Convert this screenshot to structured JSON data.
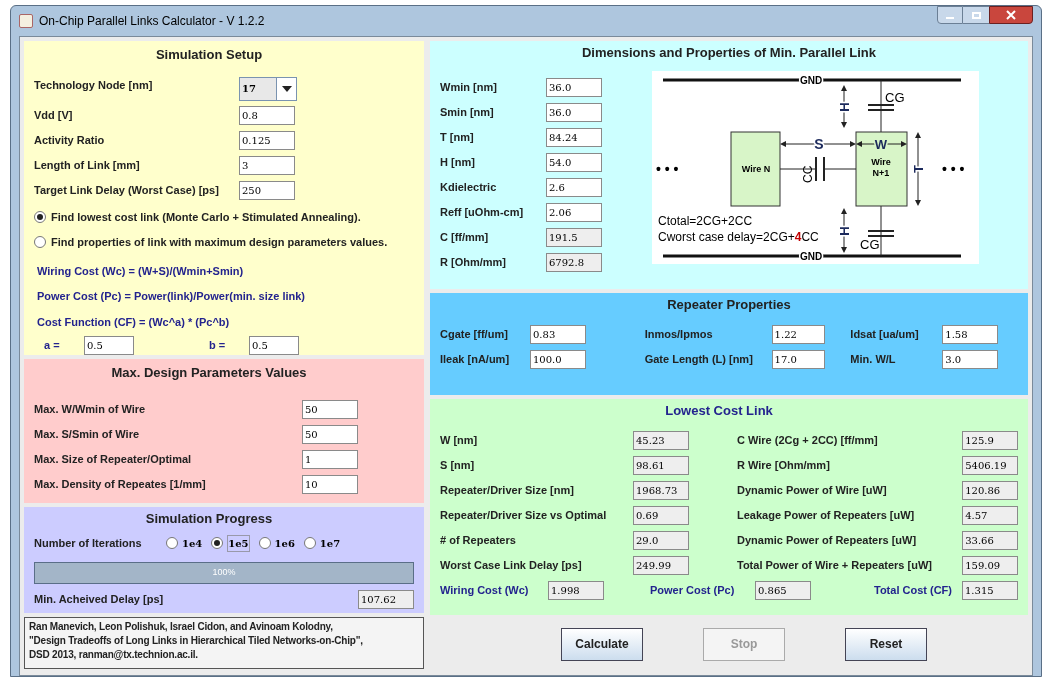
{
  "window": {
    "title": "On-Chip Parallel Links Calculator -  V 1.2.2"
  },
  "simulation_setup": {
    "title": "Simulation Setup",
    "node": {
      "label": "Technology Node [nm]",
      "value": "17"
    },
    "fields": [
      {
        "label": "Vdd [V]",
        "value": "0.8"
      },
      {
        "label": "Activity Ratio",
        "value": "0.125"
      },
      {
        "label": "Length of Link [mm]",
        "value": "3"
      },
      {
        "label": "Target Link Delay (Worst Case) [ps]",
        "value": "250"
      }
    ],
    "modes": [
      {
        "label": "Find lowest cost link (Monte Carlo + Stimulated Annealing).",
        "selected": true
      },
      {
        "label": "Find properties of link with maximum design parameters values.",
        "selected": false
      }
    ],
    "formulas": [
      "Wiring Cost (Wc) = (W+S)/(Wmin+Smin)",
      "Power Cost (Pc) = Power(link)/Power(min. size link)",
      "Cost Function (CF) = (Wc^a) * (Pc^b)"
    ],
    "exponents": [
      {
        "label": "a =",
        "value": "0.5"
      },
      {
        "label": "b =",
        "value": "0.5"
      }
    ]
  },
  "max_design": {
    "title": "Max. Design Parameters Values",
    "fields": [
      {
        "label": "Max. W/Wmin of Wire",
        "value": "50"
      },
      {
        "label": "Max. S/Smin of Wire",
        "value": "50"
      },
      {
        "label": "Max. Size of Repeater/Optimal",
        "value": "1"
      },
      {
        "label": "Max. Density of Repeates [1/mm]",
        "value": "10"
      }
    ]
  },
  "progress": {
    "title": "Simulation Progress",
    "iterations_label": "Number of Iterations",
    "iterations": [
      {
        "label": "1e4",
        "selected": false
      },
      {
        "label": "1e5",
        "selected": true
      },
      {
        "label": "1e6",
        "selected": false
      },
      {
        "label": "1e7",
        "selected": false
      }
    ],
    "bar": {
      "level": 1,
      "text": "100%"
    },
    "delay": {
      "label": "Min. Acheived Delay [ps]",
      "value": "107.62"
    }
  },
  "citation": "Ran Manevich, Leon Polishuk, Israel Cidon, and Avinoam Kolodny,\n\"Design Tradeoffs of Long Links in Hierarchical Tiled Networks-on-Chip\",\nDSD 2013, ranman@tx.technion.ac.il.",
  "dimensions": {
    "title": "Dimensions and Properties of Min. Parallel Link",
    "fields": [
      {
        "label": "Wmin [nm]",
        "value": "36.0",
        "readonly": false
      },
      {
        "label": "Smin [nm]",
        "value": "36.0",
        "readonly": false
      },
      {
        "label": "T [nm]",
        "value": "84.24",
        "readonly": false
      },
      {
        "label": "H [nm]",
        "value": "54.0",
        "readonly": false
      },
      {
        "label": "Kdielectric",
        "value": "2.6",
        "readonly": false
      },
      {
        "label": "Reff [uOhm-cm]",
        "value": "2.06",
        "readonly": false
      },
      {
        "label": "C [ff/mm]",
        "value": "191.5",
        "readonly": true
      },
      {
        "label": "R [Ohm/mm]",
        "value": "6792.8",
        "readonly": true
      }
    ],
    "diagram": {
      "gnd_top": "GND",
      "gnd_bottom": "GND",
      "cg_top": "CG",
      "cg_bottom": "CG",
      "h_top": "H",
      "h_bottom": "H",
      "s": "S",
      "w": "W",
      "wire_n": "Wire N",
      "wire_n1": [
        "Wire",
        "N+1"
      ],
      "cc": "CC",
      "t": "T",
      "dots_left": "• • •",
      "dots_right": "• • •",
      "ctotal": "Ctotal=2CG+2CC",
      "cworst": {
        "before": "Cworst case delay=2CG+",
        "highlight": "4",
        "after": "CC"
      }
    }
  },
  "repeater": {
    "title": "Repeater Properties",
    "fields": [
      {
        "label": "Cgate [ff/um]",
        "value": "0.83"
      },
      {
        "label": "Inmos/Ipmos",
        "value": "1.22"
      },
      {
        "label": "Idsat [ua/um]",
        "value": "1.58"
      },
      {
        "label": "Ileak [nA/um]",
        "value": "100.0"
      },
      {
        "label": "Gate Length (L) [nm]",
        "value": "17.0"
      },
      {
        "label": "Min. W/L",
        "value": "3.0"
      }
    ]
  },
  "lowest_cost": {
    "title": "Lowest Cost Link",
    "fields": [
      {
        "label": "W [nm]",
        "value": "45.23"
      },
      {
        "label": "C Wire (2Cg + 2CC) [ff/mm]",
        "value": "125.9"
      },
      {
        "label": "S [nm]",
        "value": "98.61"
      },
      {
        "label": "R Wire [Ohm/mm]",
        "value": "5406.19"
      },
      {
        "label": "Repeater/Driver Size [nm]",
        "value": "1968.73"
      },
      {
        "label": "Dynamic Power of Wire [uW]",
        "value": "120.86"
      },
      {
        "label": "Repeater/Driver Size vs Optimal",
        "value": "0.69"
      },
      {
        "label": "Leakage Power of Repeaters [uW]",
        "value": "4.57"
      },
      {
        "label": "# of Repeaters",
        "value": "29.0"
      },
      {
        "label": "Dynamic Power of Repeaters [uW]",
        "value": "33.66"
      },
      {
        "label": "Worst Case Link Delay [ps]",
        "value": "249.99"
      },
      {
        "label": "Total Power of Wire + Repeaters [uW]",
        "value": "159.09"
      }
    ],
    "costs": [
      {
        "label": "Wiring Cost (Wc)",
        "value": "1.998"
      },
      {
        "label": "Power Cost (Pc)",
        "value": "0.865"
      },
      {
        "label": "Total Cost (CF)",
        "value": "1.315"
      }
    ]
  },
  "buttons": [
    {
      "label": "Calculate",
      "disabled": false
    },
    {
      "label": "Stop",
      "disabled": true
    },
    {
      "label": "Reset",
      "disabled": false
    }
  ]
}
